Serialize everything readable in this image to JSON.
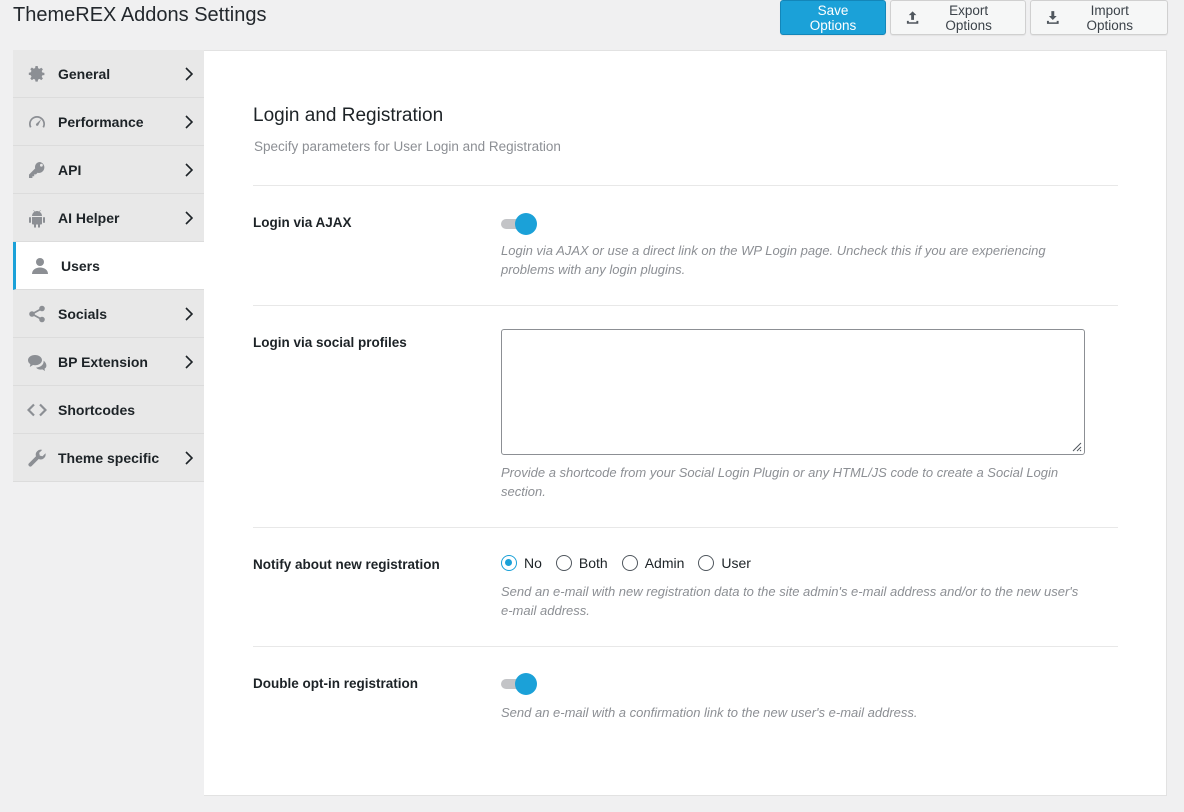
{
  "header": {
    "title": "ThemeREX Addons Settings",
    "save_label": "Save Options",
    "export_label": "Export Options",
    "import_label": "Import Options"
  },
  "sidebar": {
    "items": [
      {
        "label": "General",
        "icon": "gear-icon",
        "has_arrow": true
      },
      {
        "label": "Performance",
        "icon": "speedometer-icon",
        "has_arrow": true
      },
      {
        "label": "API",
        "icon": "key-icon",
        "has_arrow": true
      },
      {
        "label": "AI Helper",
        "icon": "android-icon",
        "has_arrow": true
      },
      {
        "label": "Users",
        "icon": "user-icon",
        "has_arrow": false,
        "active": true
      },
      {
        "label": "Socials",
        "icon": "share-icon",
        "has_arrow": true
      },
      {
        "label": "BP Extension",
        "icon": "chat-icon",
        "has_arrow": true
      },
      {
        "label": "Shortcodes",
        "icon": "code-icon",
        "has_arrow": false
      },
      {
        "label": "Theme specific",
        "icon": "wrench-icon",
        "has_arrow": true
      }
    ]
  },
  "main": {
    "title": "Login and Registration",
    "description": "Specify parameters for User Login and Registration",
    "fields": {
      "login_ajax": {
        "label": "Login via AJAX",
        "enabled": true,
        "help": "Login via AJAX or use a direct link on the WP Login page. Uncheck this if you are experiencing problems with any login plugins."
      },
      "social_profiles": {
        "label": "Login via social profiles",
        "value": "",
        "help": "Provide a shortcode from your Social Login Plugin or any HTML/JS code to create a Social Login section."
      },
      "notify": {
        "label": "Notify about new registration",
        "options": [
          "No",
          "Both",
          "Admin",
          "User"
        ],
        "selected": "No",
        "help": "Send an e-mail with new registration data to the site admin's e-mail address and/or to the new user's e-mail address."
      },
      "double_optin": {
        "label": "Double opt-in registration",
        "enabled": true,
        "help": "Send an e-mail with a confirmation link to the new user's e-mail address."
      }
    }
  },
  "colors": {
    "accent": "#1ba1d8",
    "background": "#f0f0f1"
  }
}
